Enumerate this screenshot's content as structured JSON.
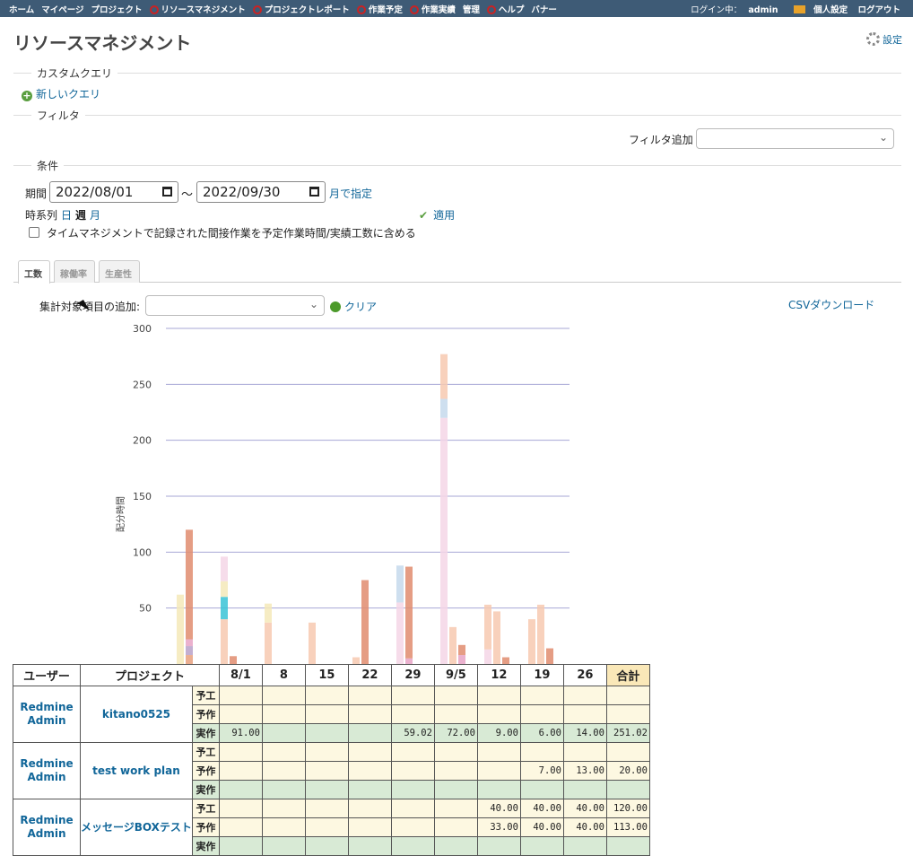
{
  "top_menu": {
    "items": [
      {
        "label": "ホーム",
        "icon": ""
      },
      {
        "label": "マイページ",
        "icon": ""
      },
      {
        "label": "プロジェクト",
        "icon": ""
      },
      {
        "label": "リソースマネジメント",
        "icon": "resource-icon"
      },
      {
        "label": "プロジェクトレポート",
        "icon": "report-icon"
      },
      {
        "label": "作業予定",
        "icon": "plan-icon"
      },
      {
        "label": "作業実績",
        "icon": "result-icon"
      },
      {
        "label": "管理",
        "icon": ""
      },
      {
        "label": "ヘルプ",
        "icon": "help-icon"
      },
      {
        "label": "バナー",
        "icon": ""
      }
    ],
    "login_label": "ログイン中：",
    "user": "admin",
    "my_account": "個人設定",
    "logout": "ログアウト"
  },
  "page": {
    "title": "リソースマネジメント",
    "settings": "設定"
  },
  "custom_query": {
    "legend": "カスタムクエリ",
    "new_query": "新しいクエリ"
  },
  "filter": {
    "legend": "フィルタ",
    "add_label": "フィルタ追加",
    "add_value": ""
  },
  "conditions": {
    "legend": "条件",
    "period_label": "期間",
    "date_from": "2022/08/01",
    "tilde": "〜",
    "date_to": "2022/09/30",
    "month_specify": "月で指定",
    "series_label": "時系列",
    "series_day": "日",
    "series_week": "週",
    "series_month": "月",
    "apply": "適用",
    "include_indirect": "タイムマネジメントで記録された間接作業を予定作業時間/実績工数に含める"
  },
  "tabs": [
    {
      "label": "工数",
      "selected": true
    },
    {
      "label": "稼働率",
      "selected": false
    },
    {
      "label": "生産性",
      "selected": false
    }
  ],
  "aggregation": {
    "label": "集計対象項目の追加:",
    "value": "",
    "clear": "クリア",
    "csv": "CSVダウンロード"
  },
  "chart_data": {
    "type": "bar",
    "ylabel": "配分時間",
    "ylim": [
      0,
      300
    ],
    "yticks": [
      50,
      100,
      150,
      200,
      250,
      300
    ],
    "grid": true,
    "colors": [
      "#f5e9b8",
      "#e8a07e",
      "#f7c9b0",
      "#c5d9ec",
      "#f4d6e6",
      "#b9a1c9",
      "#39c3d6",
      "#e59a80"
    ],
    "bars": [
      {
        "week": "8/1",
        "segments": [
          {
            "value": 62,
            "color": "#f5e9b8"
          }
        ]
      },
      {
        "week": "8/1",
        "segments": [
          {
            "value": 8,
            "color": "#e8a07e"
          },
          {
            "value": 8,
            "color": "#b9a1c9"
          },
          {
            "value": 6,
            "color": "#e8a3c6"
          },
          {
            "value": 98,
            "color": "#e08c6e"
          }
        ]
      },
      {
        "week": "8",
        "segments": [
          {
            "value": 40,
            "color": "#f7c9b0"
          },
          {
            "value": 20,
            "color": "#39c3d6"
          },
          {
            "value": 14,
            "color": "#f5e9b8"
          },
          {
            "value": 22,
            "color": "#f4d6e6"
          }
        ]
      },
      {
        "week": "8",
        "segments": [
          {
            "value": 7,
            "color": "#e08c6e"
          }
        ]
      },
      {
        "week": "15",
        "segments": [
          {
            "value": 37,
            "color": "#f7c9b0"
          },
          {
            "value": 17,
            "color": "#f5e9b8"
          }
        ]
      },
      {
        "week": "22",
        "segments": [
          {
            "value": 37,
            "color": "#f7c9b0"
          }
        ]
      },
      {
        "week": "29",
        "segments": [
          {
            "value": 6,
            "color": "#f7c9b0"
          }
        ]
      },
      {
        "week": "29",
        "segments": [
          {
            "value": 75,
            "color": "#e08c6e"
          }
        ]
      },
      {
        "week": "9/5",
        "segments": [
          {
            "value": 55,
            "color": "#f4d6e6"
          },
          {
            "value": 33,
            "color": "#c5d9ec"
          }
        ]
      },
      {
        "week": "9/5",
        "segments": [
          {
            "value": 5,
            "color": "#e8a3c6"
          },
          {
            "value": 82,
            "color": "#e08c6e"
          }
        ]
      },
      {
        "week": "12",
        "segments": [
          {
            "value": 220,
            "color": "#f4d6e6"
          },
          {
            "value": 17,
            "color": "#c5d9ec"
          },
          {
            "value": 40,
            "color": "#f7c9b0"
          }
        ]
      },
      {
        "week": "12",
        "segments": [
          {
            "value": 33,
            "color": "#f7c9b0"
          }
        ]
      },
      {
        "week": "12",
        "segments": [
          {
            "value": 8,
            "color": "#e8a3c6"
          },
          {
            "value": 9,
            "color": "#e08c6e"
          }
        ]
      },
      {
        "week": "19",
        "segments": [
          {
            "value": 13,
            "color": "#f4d6e6"
          },
          {
            "value": 40,
            "color": "#f7c9b0"
          }
        ]
      },
      {
        "week": "19",
        "segments": [
          {
            "value": 47,
            "color": "#f7c9b0"
          }
        ]
      },
      {
        "week": "19",
        "segments": [
          {
            "value": 6,
            "color": "#e08c6e"
          }
        ]
      },
      {
        "week": "26",
        "segments": [
          {
            "value": 40,
            "color": "#f7c9b0"
          }
        ]
      },
      {
        "week": "26",
        "segments": [
          {
            "value": 53,
            "color": "#f7c9b0"
          }
        ]
      },
      {
        "week": "26",
        "segments": [
          {
            "value": 14,
            "color": "#e08c6e"
          }
        ]
      }
    ]
  },
  "table": {
    "headers": [
      "ユーザー",
      "プロジェクト",
      "8/1",
      "8",
      "15",
      "22",
      "29",
      "9/5",
      "12",
      "19",
      "26",
      "合計"
    ],
    "groups": [
      {
        "user": "Redmine Admin",
        "project": "kitano0525",
        "rows": [
          {
            "kind": "予工",
            "type": "yo",
            "values": [
              "",
              "",
              "",
              "",
              "",
              "",
              "",
              "",
              "",
              ""
            ]
          },
          {
            "kind": "予作",
            "type": "yo",
            "values": [
              "",
              "",
              "",
              "",
              "",
              "",
              "",
              "",
              "",
              ""
            ]
          },
          {
            "kind": "実作",
            "type": "jitsu",
            "values": [
              "91.00",
              "",
              "",
              "",
              "59.02",
              "72.00",
              "9.00",
              "6.00",
              "14.00",
              "251.02"
            ]
          }
        ]
      },
      {
        "user": "Redmine Admin",
        "project": "test work plan",
        "rows": [
          {
            "kind": "予工",
            "type": "yo",
            "values": [
              "",
              "",
              "",
              "",
              "",
              "",
              "",
              "",
              "",
              ""
            ]
          },
          {
            "kind": "予作",
            "type": "yo",
            "values": [
              "",
              "",
              "",
              "",
              "",
              "",
              "",
              "7.00",
              "13.00",
              "20.00"
            ]
          },
          {
            "kind": "実作",
            "type": "jitsu",
            "values": [
              "",
              "",
              "",
              "",
              "",
              "",
              "",
              "",
              "",
              ""
            ]
          }
        ]
      },
      {
        "user": "Redmine Admin",
        "project": "メッセージBOXテスト",
        "rows": [
          {
            "kind": "予工",
            "type": "yo",
            "values": [
              "",
              "",
              "",
              "",
              "",
              "",
              "40.00",
              "40.00",
              "40.00",
              "120.00"
            ]
          },
          {
            "kind": "予作",
            "type": "yo",
            "values": [
              "",
              "",
              "",
              "",
              "",
              "",
              "33.00",
              "40.00",
              "40.00",
              "113.00"
            ]
          },
          {
            "kind": "実作",
            "type": "jitsu",
            "values": [
              "",
              "",
              "",
              "",
              "",
              "",
              "",
              "",
              "",
              ""
            ]
          }
        ]
      }
    ]
  }
}
